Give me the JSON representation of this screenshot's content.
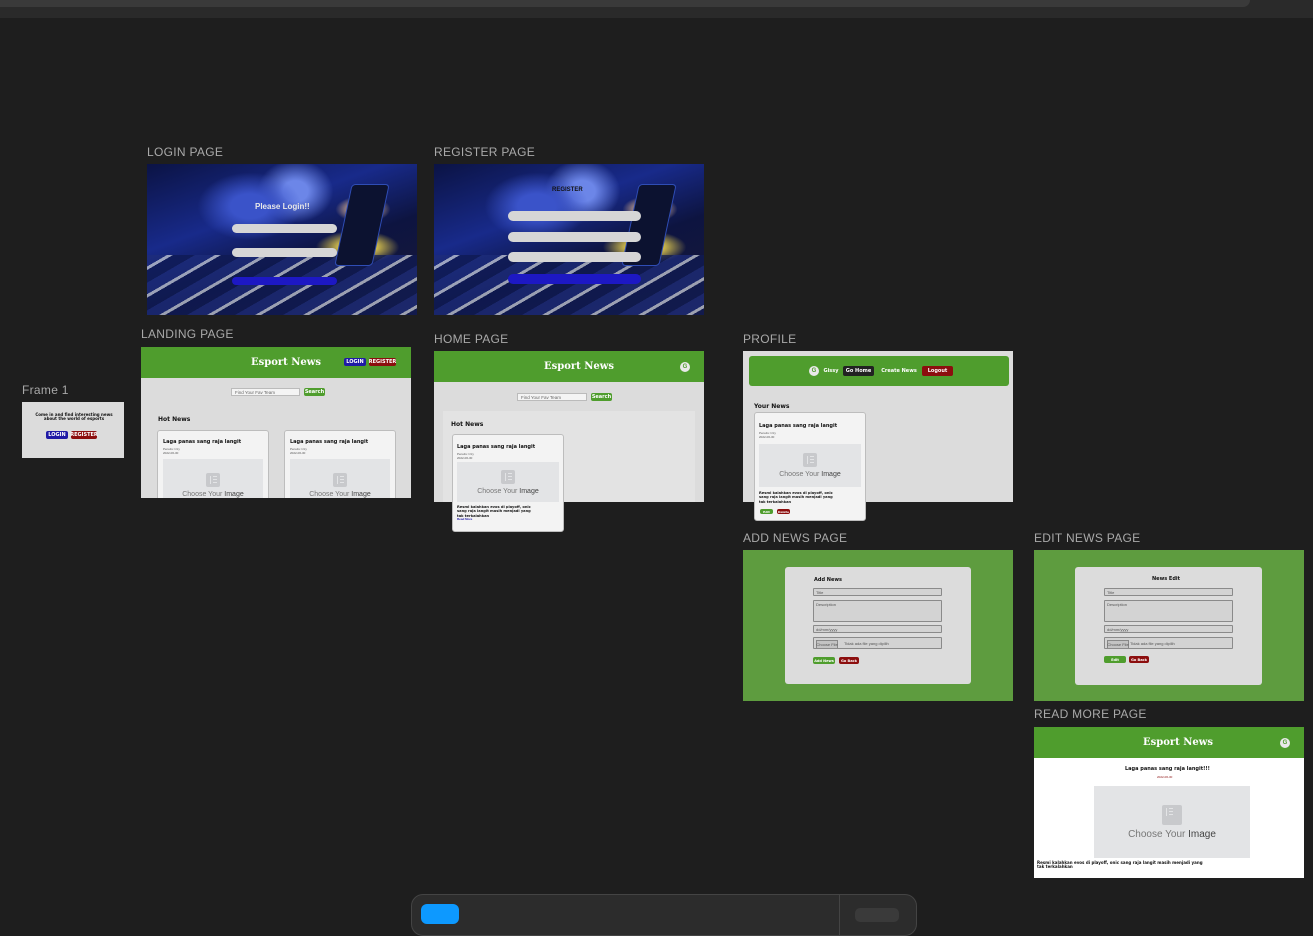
{
  "frames": {
    "frame1": {
      "label": "Frame 1",
      "heading": "Come in and find interesting news about the world of esports",
      "login": "LOGIN",
      "register": "REGISTER"
    },
    "login": {
      "label": "LOGIN PAGE",
      "title": "Please Login!!"
    },
    "register": {
      "label": "REGISTER PAGE",
      "title": "REGISTER"
    },
    "landing": {
      "label": "LANDING PAGE",
      "brand": "Esport News",
      "login": "LOGIN",
      "register": "REGISTER",
      "search_placeholder": "Find Your Fav Team",
      "search_button": "Search",
      "section": "Hot News",
      "cards": [
        {
          "title": "Laga panas sang raja langit",
          "meta1": "Penulis: Izzy",
          "meta2": "2022-06-30",
          "image_prefix": "Choose Your ",
          "image_word": "Image"
        },
        {
          "title": "Laga panas sang raja langit",
          "meta1": "Penulis: Izzy",
          "meta2": "2022-06-30",
          "image_prefix": "Choose Your ",
          "image_word": "Image"
        }
      ]
    },
    "home": {
      "label": "HOME PAGE",
      "brand": "Esport News",
      "avatar": "G",
      "search_placeholder": "Find Your Fav Team",
      "search_button": "Search",
      "section": "Hot News",
      "card": {
        "title": "Laga panas sang raja langit",
        "meta1": "Penulis: Izzy",
        "meta2": "2022-06-30",
        "image_prefix": "Choose Your ",
        "image_word": "Image",
        "desc": "Resmi kalahkan evos di playoff, onic sang raja langit masih menjadi yang tak terkalahkan",
        "read_more": "Read More"
      }
    },
    "profile": {
      "label": "PROFILE",
      "avatar": "G",
      "name": "Gissy",
      "go_home": "Go Home",
      "create_news": "Create News",
      "logout": "Logout",
      "section": "Your News",
      "card": {
        "title": "Laga panas sang raja langit",
        "meta1": "Penulis: Izzy",
        "meta2": "2022-06-30",
        "image_prefix": "Choose Your ",
        "image_word": "Image",
        "desc": "Resmi kalahkan evos di playoff, onic sang raja langit masih menjadi yang tak terkalahkan",
        "edit": "Edit",
        "delete": "Delete"
      }
    },
    "add_news": {
      "label": "ADD NEWS PAGE",
      "title": "Add News",
      "title_ph": "Title",
      "desc_ph": "Description",
      "date_ph": "dd/mm/yyyy",
      "choose_file": "Choose File",
      "no_file": "Tidak ada file yang dipilih",
      "submit": "Add News",
      "back": "Go Back"
    },
    "edit_news": {
      "label": "EDIT NEWS PAGE",
      "title": "News Edit",
      "title_ph": "Title",
      "desc_ph": "Description",
      "date_ph": "dd/mm/yyyy",
      "choose_file": "Choose File",
      "no_file": "Tidak ada file yang dipilih",
      "submit": "Edit",
      "back": "Go Back"
    },
    "read_more": {
      "label": "READ MORE PAGE",
      "brand": "Esport News",
      "avatar": "G",
      "title": "Laga panas sang raja langit!!!",
      "date": "2022-06-30",
      "image_prefix": "Choose Your ",
      "image_word": "Image",
      "desc": "Resmi kalahkan evos di playoff, onic sang raja langit masih menjadi yang tak terkalahkan"
    }
  },
  "colors": {
    "canvas": "#1e1e1e",
    "green": "#4f9d2d",
    "navy": "#1f1aa6",
    "red": "#8c0e0e"
  }
}
